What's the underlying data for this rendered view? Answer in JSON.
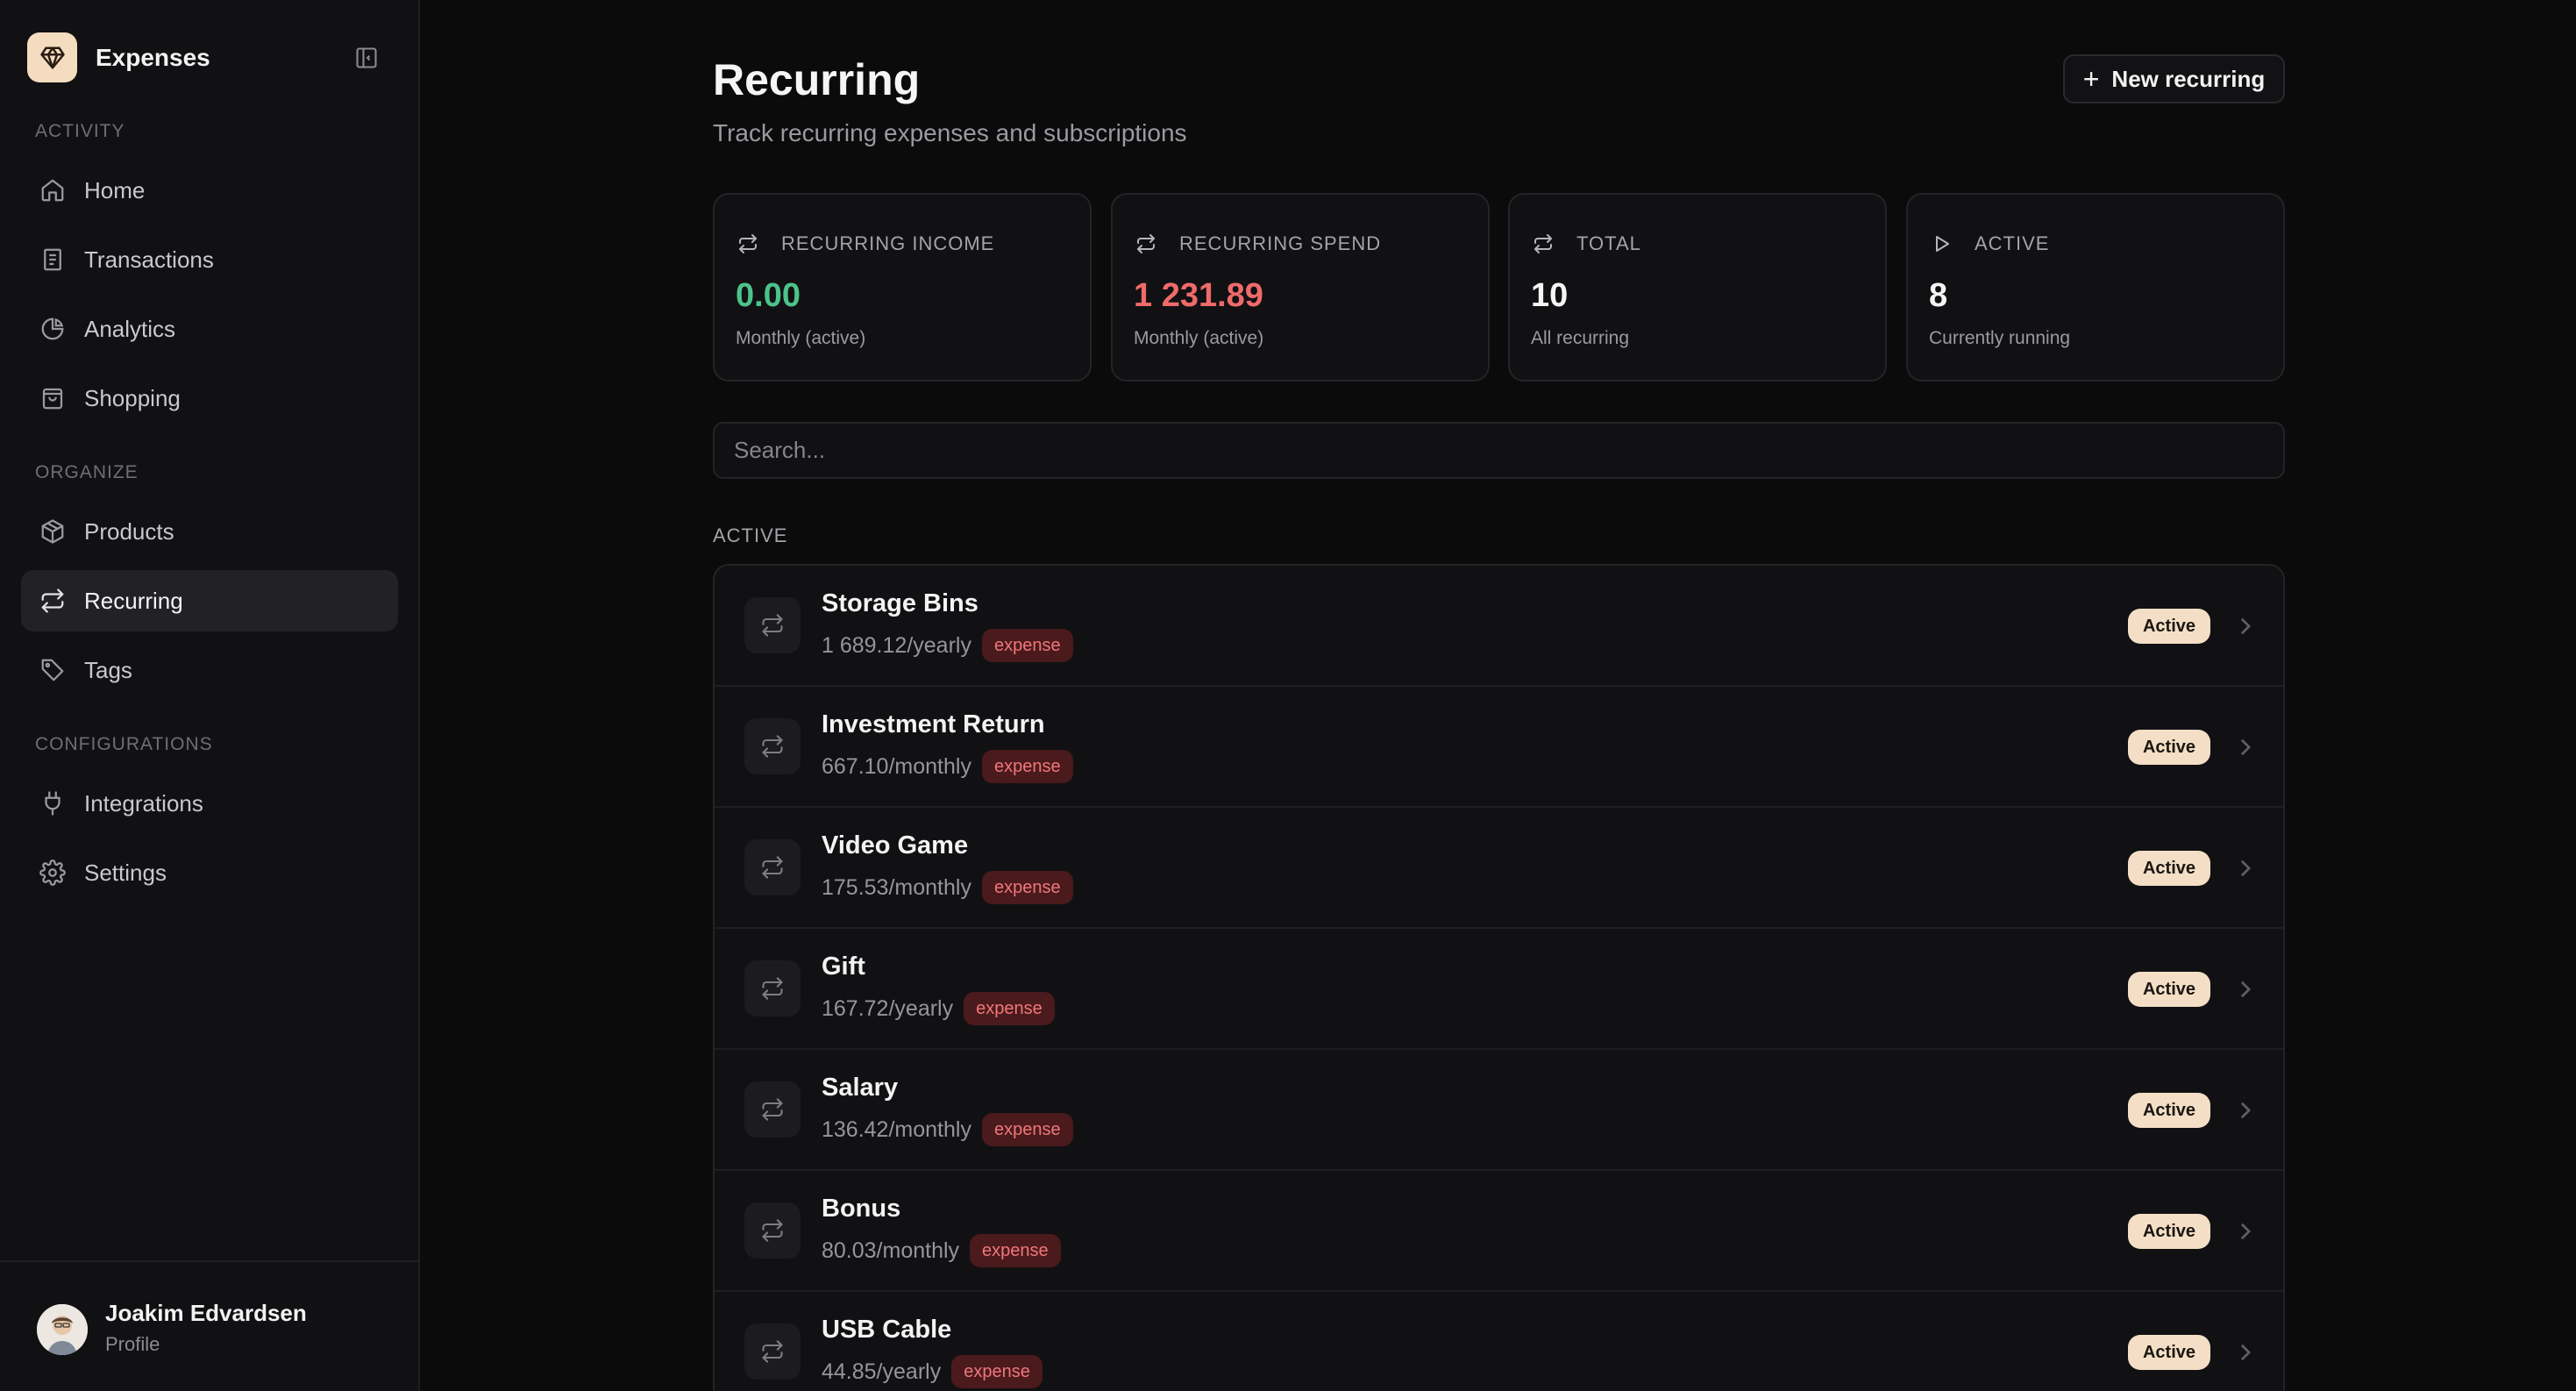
{
  "app": {
    "name": "Expenses"
  },
  "sidebar": {
    "sections": [
      {
        "label": "ACTIVITY"
      },
      {
        "label": "ORGANIZE"
      },
      {
        "label": "CONFIGURATIONS"
      }
    ],
    "items": [
      {
        "label": "Home",
        "icon": "home-icon"
      },
      {
        "label": "Transactions",
        "icon": "receipt-icon"
      },
      {
        "label": "Analytics",
        "icon": "pie-chart-icon"
      },
      {
        "label": "Shopping",
        "icon": "shopping-bag-icon"
      },
      {
        "label": "Products",
        "icon": "package-icon"
      },
      {
        "label": "Recurring",
        "icon": "repeat-icon",
        "active": true
      },
      {
        "label": "Tags",
        "icon": "tag-icon"
      },
      {
        "label": "Integrations",
        "icon": "plug-icon"
      },
      {
        "label": "Settings",
        "icon": "gear-icon"
      }
    ],
    "user": {
      "name": "Joakim Edvardsen",
      "subtitle": "Profile"
    }
  },
  "header": {
    "title": "Recurring",
    "subtitle": "Track recurring expenses and subscriptions",
    "new_button": "New recurring"
  },
  "stats": [
    {
      "label": "RECURRING INCOME",
      "value": "0.00",
      "sub": "Monthly (active)",
      "color": "#4cc38a",
      "icon": "repeat-icon"
    },
    {
      "label": "RECURRING SPEND",
      "value": "1 231.89",
      "sub": "Monthly (active)",
      "color": "#f06a6a",
      "icon": "repeat-icon"
    },
    {
      "label": "TOTAL",
      "value": "10",
      "sub": "All recurring",
      "color": "#f5f5f6",
      "icon": "repeat-icon"
    },
    {
      "label": "ACTIVE",
      "value": "8",
      "sub": "Currently running",
      "color": "#f5f5f6",
      "icon": "play-icon"
    }
  ],
  "search": {
    "placeholder": "Search..."
  },
  "list": {
    "section_label": "ACTIVE",
    "items": [
      {
        "name": "Storage Bins",
        "amount": "1 689.12/yearly",
        "tag": "expense",
        "status": "Active"
      },
      {
        "name": "Investment Return",
        "amount": "667.10/monthly",
        "tag": "expense",
        "status": "Active"
      },
      {
        "name": "Video Game",
        "amount": "175.53/monthly",
        "tag": "expense",
        "status": "Active"
      },
      {
        "name": "Gift",
        "amount": "167.72/yearly",
        "tag": "expense",
        "status": "Active"
      },
      {
        "name": "Salary",
        "amount": "136.42/monthly",
        "tag": "expense",
        "status": "Active"
      },
      {
        "name": "Bonus",
        "amount": "80.03/monthly",
        "tag": "expense",
        "status": "Active"
      },
      {
        "name": "USB Cable",
        "amount": "44.85/yearly",
        "tag": "expense",
        "status": "Active"
      }
    ]
  },
  "colors": {
    "accent": "#f4dcc0",
    "income": "#4cc38a",
    "spend": "#f06a6a",
    "tag_bg": "#4a1a1c",
    "tag_text": "#f0777a"
  }
}
